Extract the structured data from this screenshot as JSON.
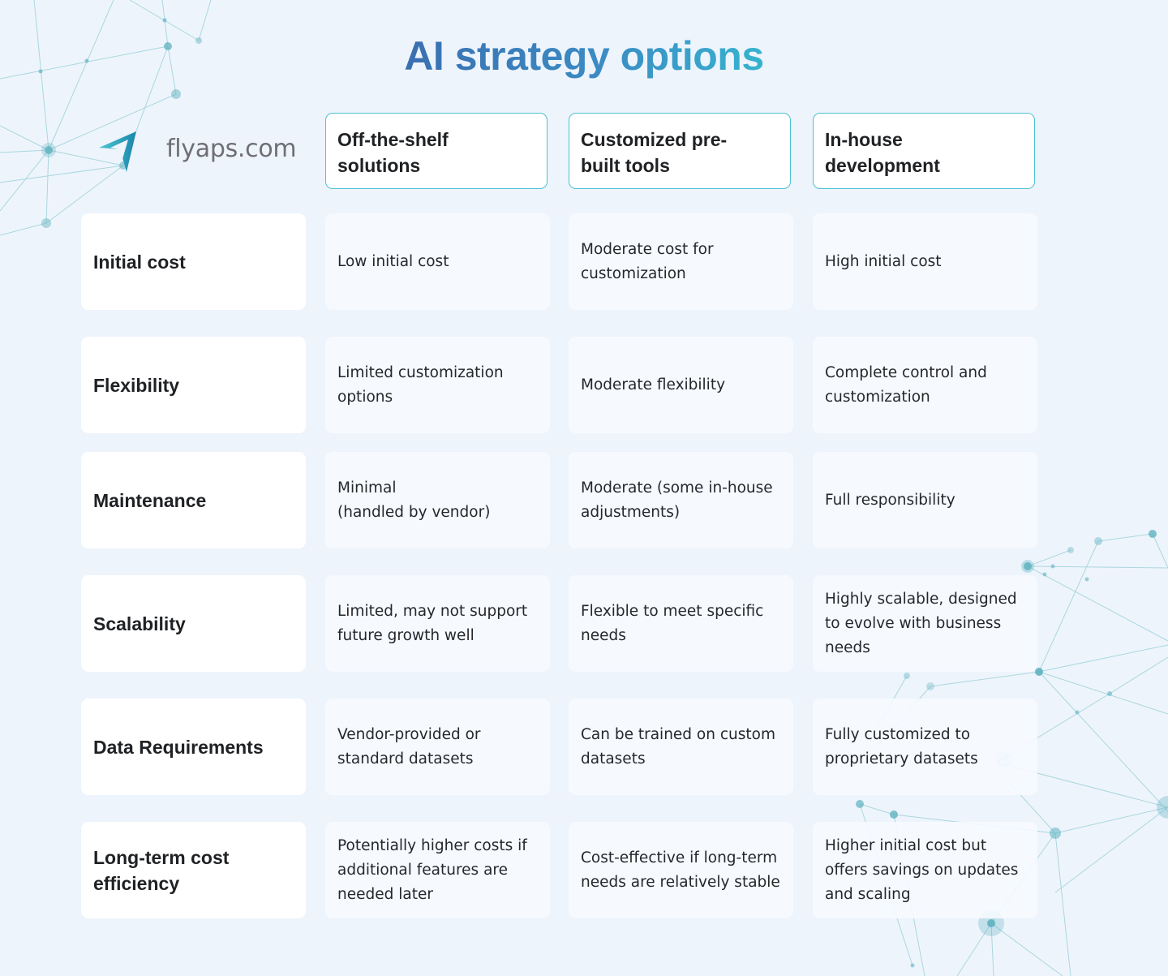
{
  "title": "AI strategy options",
  "brand": {
    "logo_icon": "paper-plane-arrow-icon",
    "name": "flyaps.com"
  },
  "colors": {
    "title_gradient_start": "#3a6fb0",
    "title_gradient_end": "#36b3cf",
    "header_border": "#4cc2cf",
    "background": "#eef4fc",
    "network_accent": "#5fb3bf"
  },
  "columns": [
    {
      "label": "Off-the-shelf solutions",
      "display": "Off-the-shelf\nsolutions"
    },
    {
      "label": "Customized pre-built tools",
      "display": "Customized pre-\nbuilt tools"
    },
    {
      "label": "In-house development",
      "display": "In-house\ndevelopment"
    }
  ],
  "rows": [
    {
      "label": "Initial cost",
      "cells": [
        "Low initial cost",
        "Moderate cost for customization",
        "High initial cost"
      ]
    },
    {
      "label": "Flexibility",
      "cells": [
        "Limited customization options",
        "Moderate flexibility",
        "Complete control and customization"
      ]
    },
    {
      "label": "Maintenance",
      "cells": [
        "Minimal\n(handled by vendor)",
        "Moderate (some in-house adjustments)",
        "Full responsibility"
      ]
    },
    {
      "label": "Scalability",
      "cells": [
        "Limited, may not support future growth well",
        "Flexible to meet specific needs",
        "Highly scalable, designed to evolve with business needs"
      ]
    },
    {
      "label": "Data Requirements",
      "cells": [
        "Vendor-provided or standard datasets",
        "Can be trained on custom datasets",
        "Fully customized to proprietary datasets"
      ]
    },
    {
      "label": "Long-term cost efficiency",
      "cells": [
        "Potentially higher costs if additional features are needed later",
        "Cost-effective if long-term needs are relatively stable",
        "Higher initial cost but offers savings on updates and scaling"
      ]
    }
  ]
}
